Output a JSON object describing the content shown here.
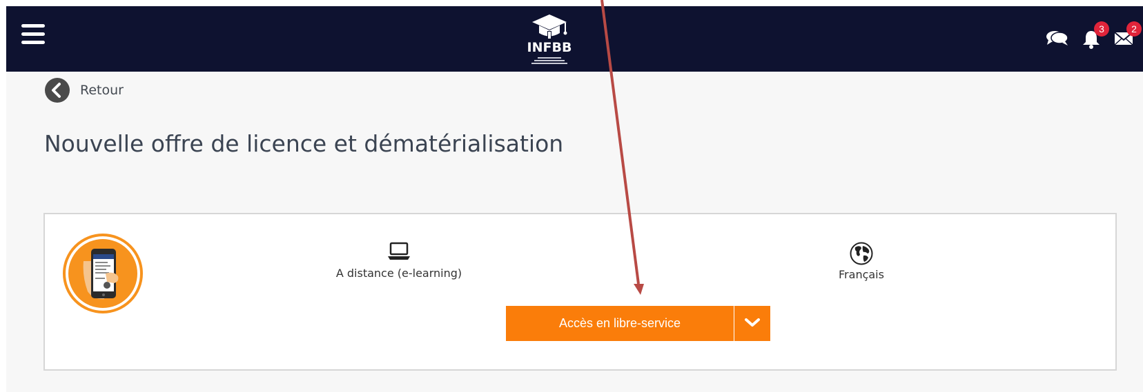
{
  "header": {
    "logo_text": "INFBB",
    "notifications_count": "3",
    "messages_count": "2",
    "icons": [
      "menu-icon",
      "chat-icon",
      "bell-icon",
      "mail-icon"
    ],
    "background_color": "#0e1230",
    "badge_color": "#e0243a"
  },
  "nav": {
    "back_label": "Retour"
  },
  "page": {
    "title": "Nouvelle offre de licence et dématérialisation"
  },
  "course": {
    "mode_label": "A distance (e-learning)",
    "language_label": "Français",
    "cta_label": "Accès en libre-service",
    "accent_color": "#fa7d0a"
  }
}
